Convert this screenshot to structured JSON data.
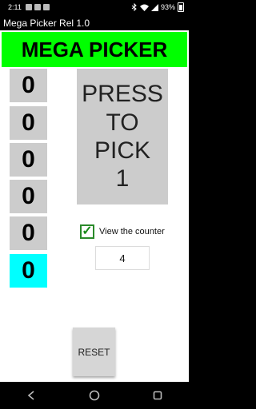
{
  "status_bar": {
    "time": "2:11",
    "battery": "93%"
  },
  "app": {
    "title": "Mega Picker Rel 1.0",
    "banner": "MEGA PICKER"
  },
  "counters": [
    "0",
    "0",
    "0",
    "0",
    "0",
    "0"
  ],
  "active_counter_index": 5,
  "press_button": {
    "line1": "PRESS",
    "line2": "TO",
    "line3": "PICK",
    "line4": "1"
  },
  "view_counter": {
    "label": "View the counter",
    "checked": true,
    "value": "4"
  },
  "reset_label": "RESET",
  "colors": {
    "banner": "#00ff00",
    "active_counter": "#00ffff",
    "counter": "#cccccc",
    "check": "#2a8a2a"
  }
}
